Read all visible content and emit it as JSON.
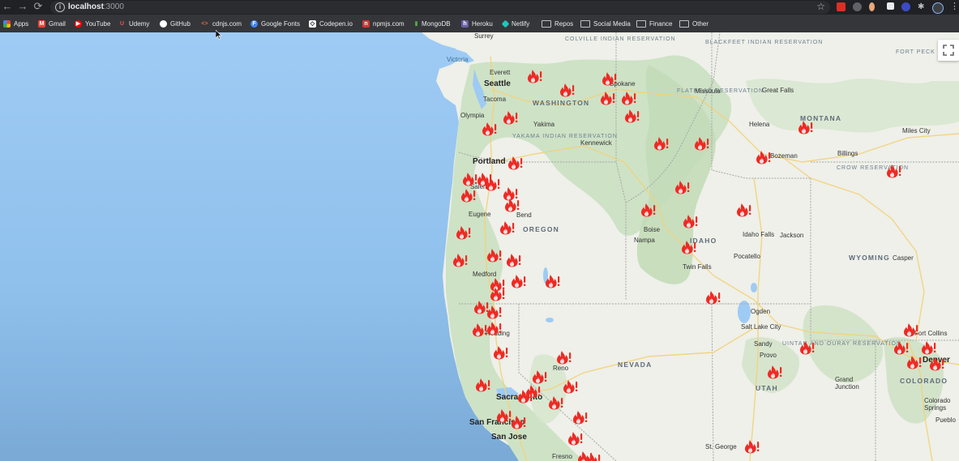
{
  "browser": {
    "url_host": "localhost",
    "url_port": ":3000"
  },
  "bookmarks": [
    {
      "label": "Apps",
      "icon": "apps-icon",
      "color": "#ea4335"
    },
    {
      "label": "Gmail",
      "icon": "gmail-icon",
      "color": "#ea4335"
    },
    {
      "label": "YouTube",
      "icon": "youtube-icon",
      "color": "#ff0000"
    },
    {
      "label": "Udemy",
      "icon": "udemy-icon",
      "color": "#ec5252"
    },
    {
      "label": "GitHub",
      "icon": "github-icon",
      "color": "#ffffff"
    },
    {
      "label": "cdnjs.com",
      "icon": "code-icon",
      "color": "#e06c4d"
    },
    {
      "label": "Google Fonts",
      "icon": "google-fonts-icon",
      "color": "#4285f4"
    },
    {
      "label": "Codepen.io",
      "icon": "codepen-icon",
      "color": "#ffffff"
    },
    {
      "label": "npmjs.com",
      "icon": "npm-icon",
      "color": "#cb3837"
    },
    {
      "label": "MongoDB",
      "icon": "mongodb-icon",
      "color": "#4faa41"
    },
    {
      "label": "Heroku",
      "icon": "heroku-icon",
      "color": "#6762a6"
    },
    {
      "label": "Netlify",
      "icon": "netlify-icon",
      "color": "#20c6b7"
    },
    {
      "label": "Repos",
      "icon": "folder-icon",
      "color": "#bdc1c6"
    },
    {
      "label": "Social Media",
      "icon": "folder-icon",
      "color": "#bdc1c6"
    },
    {
      "label": "Finance",
      "icon": "folder-icon",
      "color": "#bdc1c6"
    },
    {
      "label": "Other",
      "icon": "folder-icon",
      "color": "#bdc1c6"
    }
  ],
  "map": {
    "states": [
      "WASHINGTON",
      "OREGON",
      "IDAHO",
      "MONTANA",
      "WYOMING",
      "NEVADA",
      "UTAH",
      "COLORADO"
    ],
    "cities": [
      "Surrey",
      "Victoria",
      "Everett",
      "Seattle",
      "Tacoma",
      "Olympia",
      "Spokane",
      "Yakima",
      "Kennewick",
      "Missoula",
      "Helena",
      "Great Falls",
      "Bozeman",
      "Billings",
      "Miles City",
      "Portland",
      "Salem",
      "Eugene",
      "Bend",
      "Medford",
      "Redding",
      "Boise",
      "Nampa",
      "Twin Falls",
      "Idaho Falls",
      "Jackson",
      "Pocatello",
      "Casper",
      "Ogden",
      "Salt Lake City",
      "Sandy",
      "Provo",
      "Reno",
      "Sacramento",
      "San Francisco",
      "San Jose",
      "Fresno",
      "St. George",
      "Grand Junction",
      "Fort Collins",
      "Denver",
      "Colorado Springs",
      "Pueblo"
    ],
    "reservations": [
      "COLVILLE INDIAN RESERVATION",
      "BLACKFEET INDIAN RESERVATION",
      "FORT PECK INDIAN RESERVATION",
      "FLATHEAD RESERVATION",
      "YAKAMA INDIAN RESERVATION",
      "CROW RESERVATION",
      "UINTAH AND OURAY RESERVATION"
    ],
    "fire_color": "#ee2a24"
  }
}
